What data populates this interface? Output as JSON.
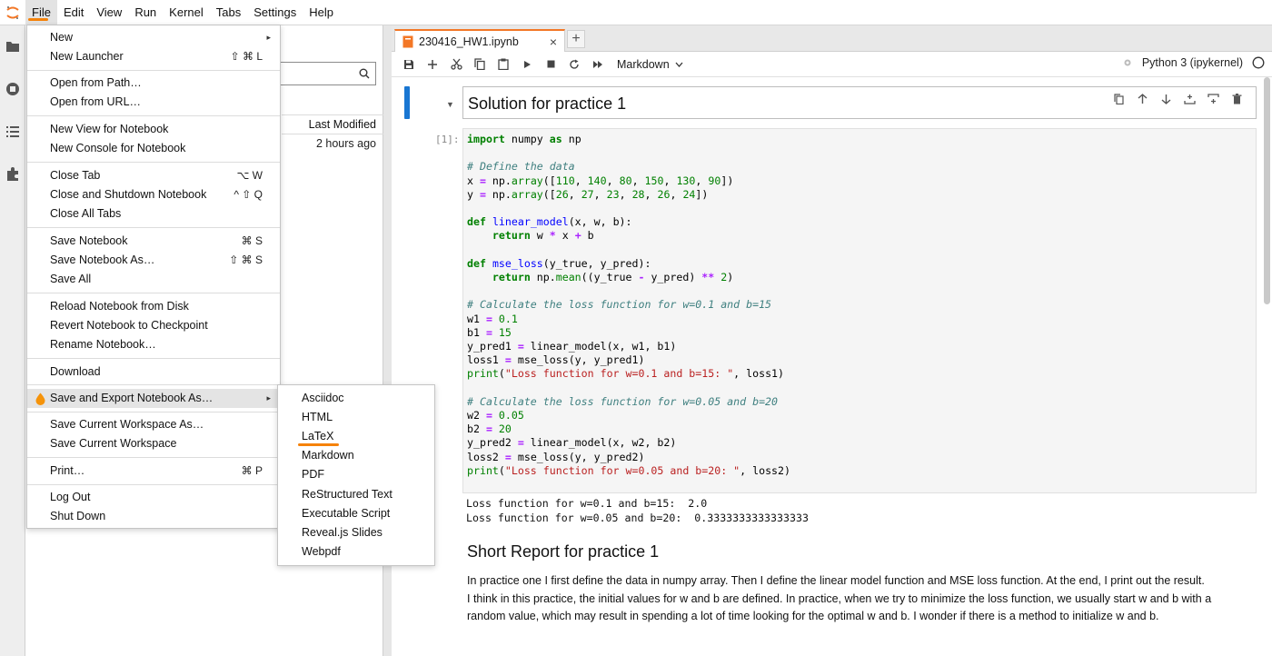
{
  "menubar": {
    "items": [
      "File",
      "Edit",
      "View",
      "Run",
      "Kernel",
      "Tabs",
      "Settings",
      "Help"
    ]
  },
  "file_browser": {
    "column_last_modified": "Last Modified",
    "row_time": "2 hours ago"
  },
  "notebook": {
    "tab_title": "230416_HW1.ipynb",
    "cell_type": "Markdown",
    "kernel_name": "Python 3 (ipykernel)",
    "heading_cell": "Solution for practice 1",
    "input_prompt": "[1]:",
    "output_lines": [
      "Loss function for w=0.1 and b=15:  2.0",
      "Loss function for w=0.05 and b=20:  0.3333333333333333"
    ],
    "report_heading": "Short Report for practice 1",
    "report_paragraphs": [
      "In practice one I first define the data in numpy array. Then I define the linear model function and MSE loss function. At the end, I print out the result.",
      "I think in this practice, the initial values for w and b are defined. In practice, when we try to minimize the loss function, we usually start w and b with a random value, which may result in spending a lot of time looking for the optimal w and b. I wonder if there is a method to initialize w and b."
    ]
  },
  "file_menu": {
    "items": [
      {
        "label": "New",
        "shortcut": "",
        "submenu": true
      },
      {
        "label": "New Launcher",
        "shortcut": "⇧ ⌘ L"
      },
      {
        "label": "Open from Path…",
        "shortcut": ""
      },
      {
        "label": "Open from URL…",
        "shortcut": ""
      },
      {
        "label": "New View for Notebook",
        "shortcut": ""
      },
      {
        "label": "New Console for Notebook",
        "shortcut": ""
      },
      {
        "label": "Close Tab",
        "shortcut": "⌥ W"
      },
      {
        "label": "Close and Shutdown Notebook",
        "shortcut": "^ ⇧ Q"
      },
      {
        "label": "Close All Tabs",
        "shortcut": ""
      },
      {
        "label": "Save Notebook",
        "shortcut": "⌘ S"
      },
      {
        "label": "Save Notebook As…",
        "shortcut": "⇧ ⌘ S"
      },
      {
        "label": "Save All",
        "shortcut": ""
      },
      {
        "label": "Reload Notebook from Disk",
        "shortcut": ""
      },
      {
        "label": "Revert Notebook to Checkpoint",
        "shortcut": ""
      },
      {
        "label": "Rename Notebook…",
        "shortcut": ""
      },
      {
        "label": "Download",
        "shortcut": ""
      },
      {
        "label": "Save and Export Notebook As…",
        "shortcut": "",
        "submenu": true
      },
      {
        "label": "Save Current Workspace As…",
        "shortcut": ""
      },
      {
        "label": "Save Current Workspace",
        "shortcut": ""
      },
      {
        "label": "Print…",
        "shortcut": "⌘ P"
      },
      {
        "label": "Log Out",
        "shortcut": ""
      },
      {
        "label": "Shut Down",
        "shortcut": ""
      }
    ]
  },
  "export_menu": {
    "items": [
      "Asciidoc",
      "HTML",
      "LaTeX",
      "Markdown",
      "PDF",
      "ReStructured Text",
      "Executable Script",
      "Reveal.js Slides",
      "Webpdf"
    ]
  },
  "colors": {
    "accent_orange": "#f5820a",
    "active_cell_blue": "#1976d2",
    "jupyter_orange": "#f37726"
  },
  "icons": {
    "activity_bar": [
      "folder-icon",
      "running-icon",
      "toc-icon",
      "extension-icon"
    ],
    "toolbar": [
      "save-icon",
      "add-cell-icon",
      "cut-icon",
      "copy-icon",
      "paste-icon",
      "run-icon",
      "stop-icon",
      "restart-icon",
      "run-all-icon"
    ]
  }
}
